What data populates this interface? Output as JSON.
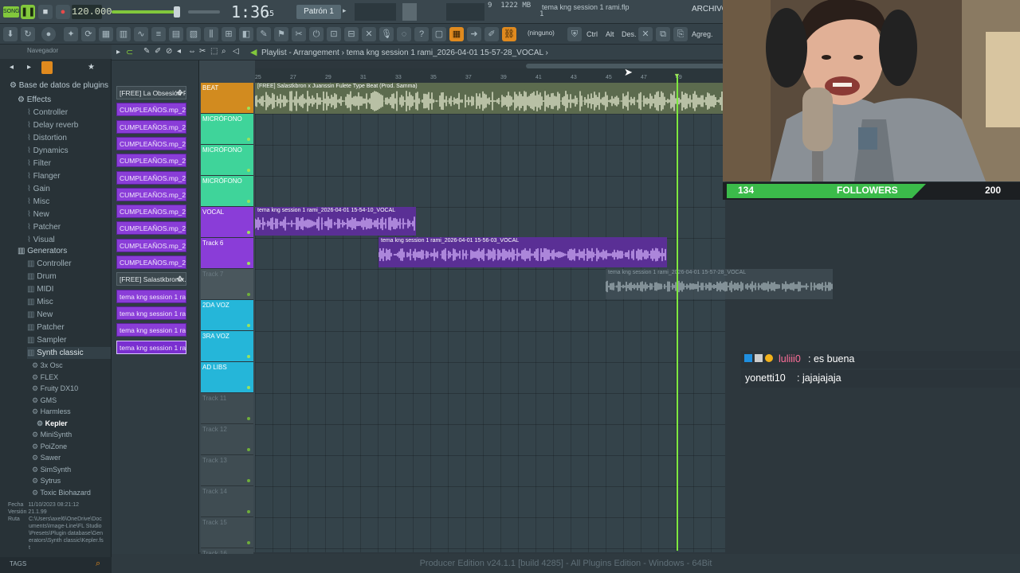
{
  "topbar": {
    "bpm": "120.000",
    "time": "1:36",
    "time_unit": "15",
    "pattern": "Patrón 1",
    "cpu_num": "9",
    "mem": "1222 MB",
    "poly": "1",
    "hint": "tema kng session 1 rami.flp",
    "archivo": "ARCHIVO (",
    "song_mode": "SONG"
  },
  "toolbar2": {
    "none_label": "(ninguno)",
    "ctrl": "Ctrl",
    "alt": "Alt",
    "des": "Des.",
    "agreg": "Agreg."
  },
  "browser": {
    "nav_label": "Navegador",
    "root": "Base de datos de plugins",
    "effects": "Effects",
    "effects_items": [
      "Controller",
      "Delay reverb",
      "Distortion",
      "Dynamics",
      "Filter",
      "Flanger",
      "Gain",
      "Misc",
      "New",
      "Patcher",
      "Visual"
    ],
    "generators": "Generators",
    "generators_items": [
      "Controller",
      "Drum",
      "MIDI",
      "Misc",
      "New",
      "Patcher",
      "Sampler",
      "Synth classic"
    ],
    "synth_items": [
      "3x Osc",
      "FLEX",
      "Fruity DX10",
      "GMS",
      "Harmless",
      "Kepler",
      "MiniSynth",
      "PoiZone",
      "Sawer",
      "SimSynth",
      "Sytrus",
      "Toxic Biohazard"
    ],
    "info_fecha_label": "Fecha",
    "info_fecha": "11/10/2023 08:21:12",
    "info_version_label": "Versión",
    "info_version": "21.1.99",
    "info_ruta_label": "Ruta",
    "info_ruta": "C:\\Users\\axel6\\OneDrive\\Documents\\Image-Line\\FL Studio\\Presets\\Plugin database\\Generators\\Synth classic\\Kepler.fst",
    "tags": "TAGS"
  },
  "chanlist": [
    "[FREE] La Obsesión F...",
    "CUMPLEAÑOS.mp_2026-0...",
    "CUMPLEAÑOS.mp_2026-0...",
    "CUMPLEAÑOS.mp_2026-0...",
    "CUMPLEAÑOS.mp_2026-0...",
    "CUMPLEAÑOS.mp_2026-0...",
    "CUMPLEAÑOS.mp_2026-0...",
    "CUMPLEAÑOS.mp_2026-0...",
    "CUMPLEAÑOS.mp_2026-0...",
    "CUMPLEAÑOS.mp_2026-0...",
    "CUMPLEAÑOS.mp_2026-0...",
    "[FREE] Salastkbron x...",
    "tema kng session 1 rami...",
    "tema kng session 1 rami...",
    "tema kng session 1 rami...",
    "tema kng session 1 rami..."
  ],
  "playlist": {
    "title": "Playlist - Arrangement",
    "breadcrumb": "tema kng session 1 rami_2026-04-01 15-57-28_VOCAL",
    "ruler": [
      "25",
      "27",
      "29",
      "31",
      "33",
      "35",
      "37",
      "39",
      "41",
      "43",
      "45",
      "47",
      "49"
    ],
    "tracks": [
      "BEAT",
      "MICRÓFONO",
      "MICRÓFONO",
      "MICRÓFONO",
      "VOCAL",
      "Track 6",
      "Track 7",
      "2DA VOZ",
      "3RA VOZ",
      "AD LIBS",
      "Track 11",
      "Track 12",
      "Track 13",
      "Track 14",
      "Track 15",
      "Track 16"
    ],
    "clips": {
      "beat": "[FREE] Salastkbron x Juanssin Fulete Type Beat (Prod. Samma)",
      "vocal1": "tema kng session 1 rami_2026-04-01 15-54-10_VOCAL",
      "vocal2": "tema kng session 1 rami_2026-04-01 15-56-03_VOCAL",
      "vocal3": "tema kng session 1 rami_2026-04-01 15-57-28_VOCAL"
    }
  },
  "status": "Producer Edition v24.1.1 [build 4285] - All Plugins Edition - Windows - 64Bit",
  "overlay": {
    "followers_count": "134",
    "followers_label": "FOLLOWERS",
    "followers_goal": "200",
    "followers_progress": 0.67,
    "chat": [
      {
        "user": "luliii0",
        "msg": ": es buena",
        "color": "#ff6f9a"
      },
      {
        "user": "yonetti10",
        "msg": ": jajajajaja",
        "color": "#ffffff"
      }
    ]
  },
  "colors": {
    "beat": "#d28b1f",
    "mic": "#3fd49a",
    "vocal": "#8a3dd8",
    "voz": "#25b6d9",
    "playhead": "#7ee840"
  }
}
